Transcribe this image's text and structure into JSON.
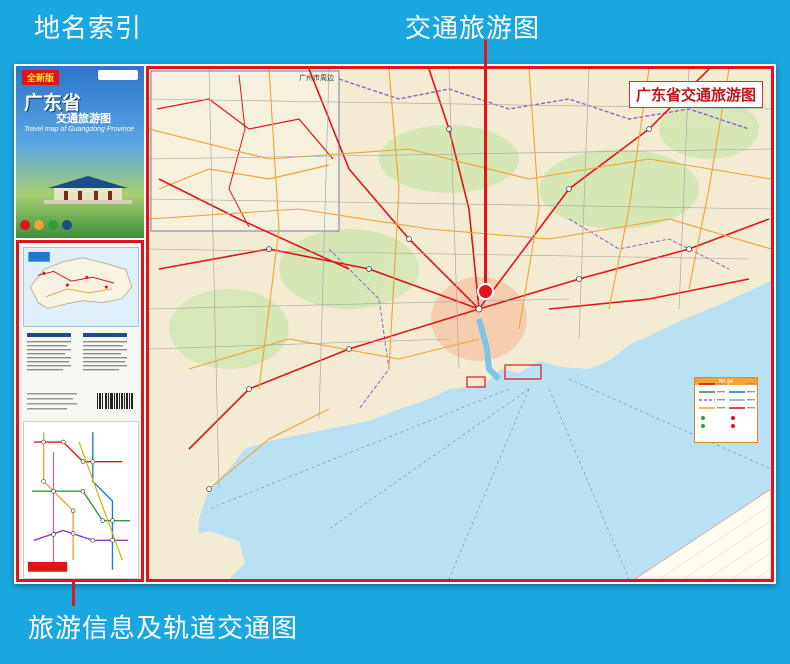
{
  "labels": {
    "place_index": "地名索引",
    "traffic_map": "交通旅游图",
    "travel_info": "旅游信息及轨道交通图"
  },
  "cover": {
    "badge": "全新版",
    "title": "广东省",
    "subtitle": "交通旅游图",
    "english": "Travel map of Guangdong Province"
  },
  "map": {
    "title": "广东省交通旅游图",
    "inset_label": "广州市周边",
    "legend_title": "图 例"
  },
  "colors": {
    "background": "#1aa7e0",
    "accent_red": "#e0141b",
    "sea": "#b9e0f3",
    "land": "#f3ecd2"
  }
}
